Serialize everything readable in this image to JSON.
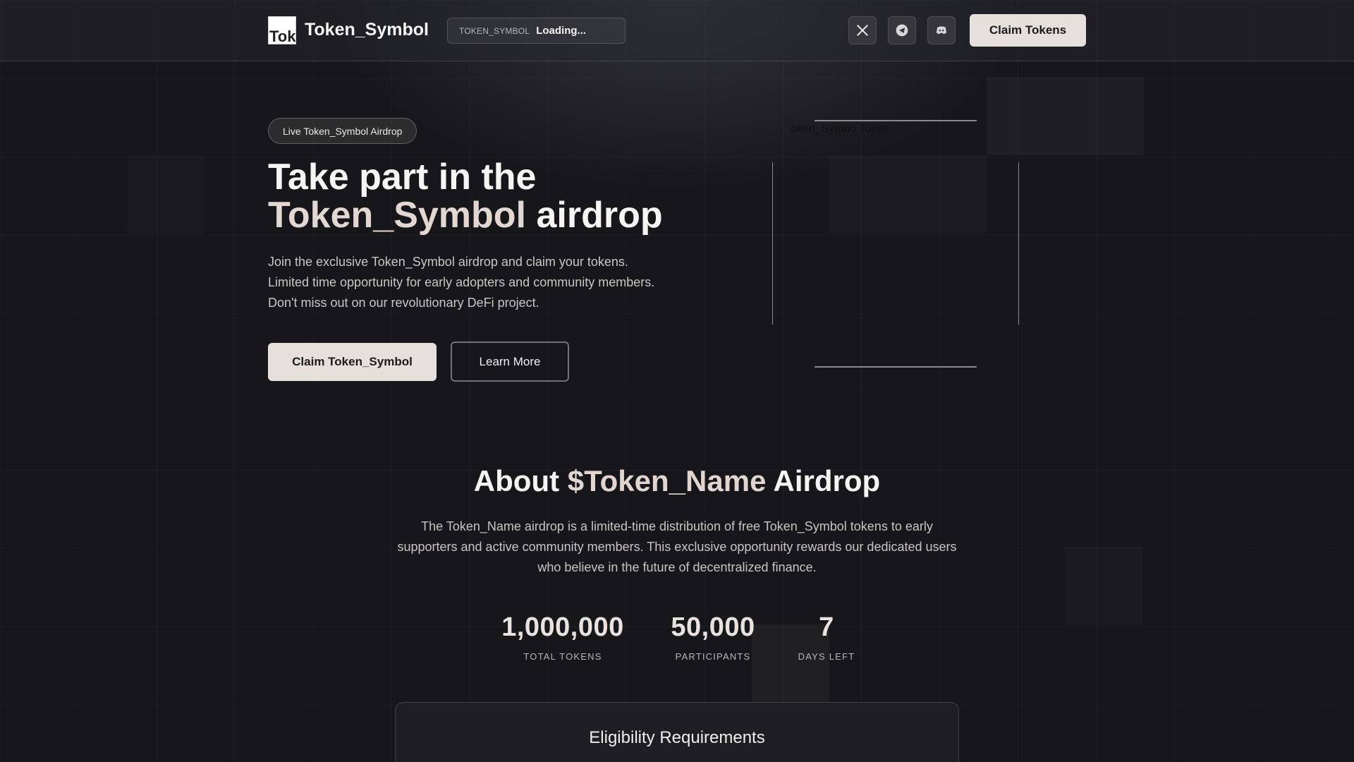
{
  "header": {
    "logo_alt": "Tok",
    "logo_text": "Token_Symbol",
    "ticker_symbol": "TOKEN_SYMBOL",
    "ticker_value": "Loading...",
    "social": [
      {
        "name": "x",
        "icon": "x-icon"
      },
      {
        "name": "telegram",
        "icon": "telegram-icon"
      },
      {
        "name": "discord",
        "icon": "discord-icon"
      }
    ],
    "claim_label": "Claim Tokens"
  },
  "hero": {
    "badge": "Live Token_Symbol Airdrop",
    "title_line1": "Take part in the",
    "title_accent": "Token_Symbol",
    "title_rest": " airdrop",
    "description": " Join the exclusive Token_Symbol airdrop and claim your tokens. Limited time opportunity for early adopters and community members. Don't miss out on our revolutionary DeFi project.",
    "primary_label": "Claim Token_Symbol",
    "secondary_label": "Learn More",
    "card_label": "oken_Symbo Token"
  },
  "about": {
    "title_start": "About ",
    "title_accent": "$Token_Name",
    "title_end": " Airdrop",
    "description": "The Token_Name airdrop is a limited-time distribution of free Token_Symbol tokens to early supporters and active community members. This exclusive opportunity rewards our dedicated users who believe in the future of decentralized finance.",
    "stats": [
      {
        "value": "1,000,000",
        "label": "TOTAL TOKENS"
      },
      {
        "value": "50,000",
        "label": "PARTICIPANTS"
      },
      {
        "value": "7",
        "label": "DAYS LEFT"
      }
    ],
    "eligibility_title": "Eligibility Requirements"
  },
  "colors": {
    "background": "#17171b",
    "accent": "#e2d7d1",
    "button": "#e6dfdc"
  }
}
